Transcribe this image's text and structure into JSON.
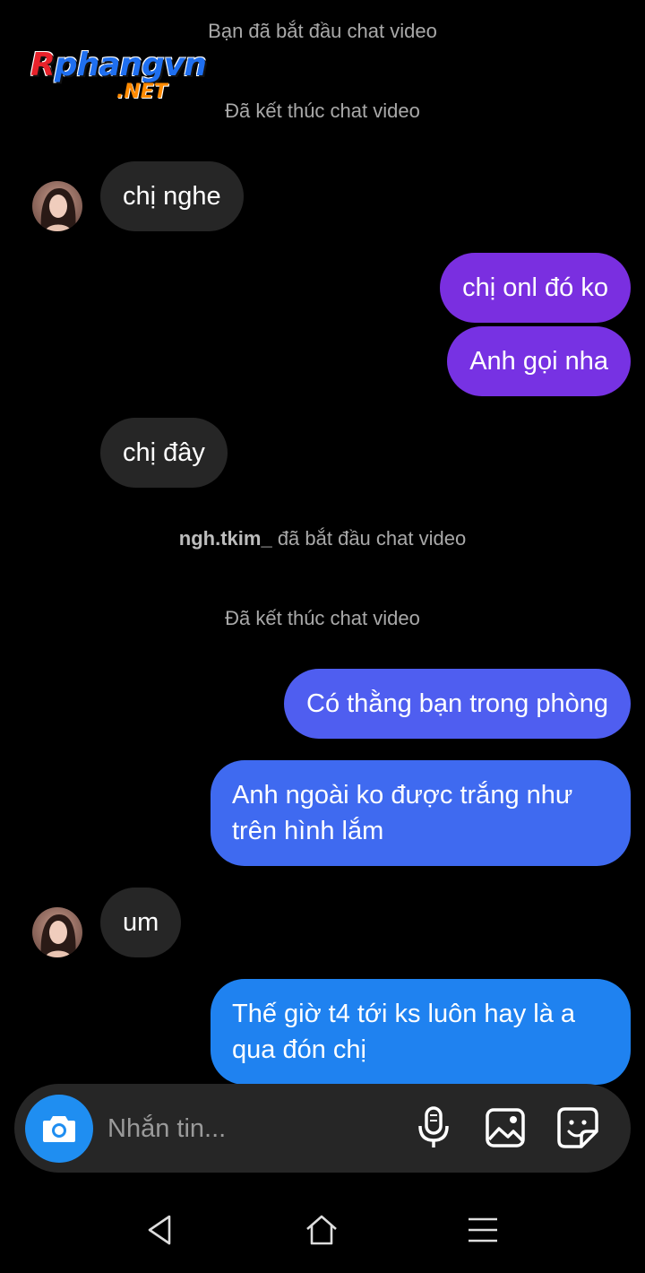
{
  "watermark": {
    "brand_main": "Rphangvn",
    "brand_main_first": "R",
    "brand_main_rest": "phangvn",
    "brand_tld": ".NET"
  },
  "system_messages": {
    "video_start_1": "Bạn đã bắt đầu chat video",
    "video_end_1": "Đã kết thúc chat video",
    "video_start_2_user": "ngh.tkim_",
    "video_start_2_text": "đã bắt đầu chat video",
    "video_end_2": "Đã kết thúc chat video"
  },
  "messages": [
    {
      "side": "in",
      "text": "chị nghe"
    },
    {
      "side": "out",
      "text": "chị onl đó ko",
      "color": "#7a2fe0"
    },
    {
      "side": "out",
      "text": "Anh gọi nha",
      "color": "#7732e3"
    },
    {
      "side": "in",
      "text": "chị đây"
    },
    {
      "side": "out",
      "text": "Có thằng bạn trong phòng",
      "color": "#4f5ef0"
    },
    {
      "side": "out",
      "text": "Anh ngoài ko được trắng như trên hình lắm",
      "color": "#3f6af0"
    },
    {
      "side": "in",
      "text": "um"
    },
    {
      "side": "out",
      "text": "Thế giờ t4 tới ks luôn hay là a qua đón chị",
      "color": "#1f82f0"
    }
  ],
  "composer": {
    "placeholder": "Nhắn tin...",
    "icons": [
      "camera-icon",
      "microphone-icon",
      "gallery-icon",
      "sticker-icon"
    ],
    "camera_color": "#1f8ef1"
  },
  "nav": {
    "icons": [
      "back-icon",
      "home-icon",
      "menu-icon"
    ]
  }
}
